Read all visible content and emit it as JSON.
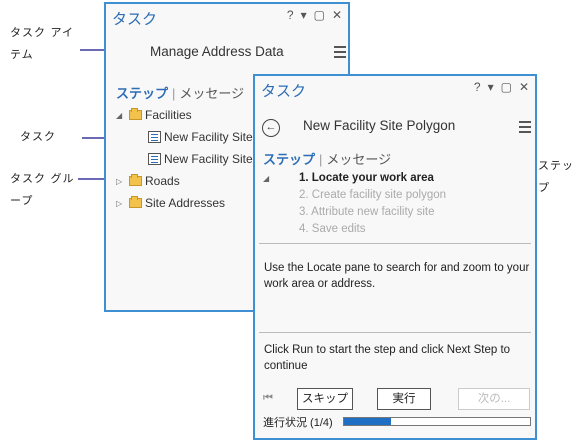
{
  "callouts": {
    "task_item": "タスク アイテム",
    "task": "タスク",
    "task_group": "タスク グループ",
    "step": "ステップ"
  },
  "back_pane": {
    "title": "タスク",
    "controls": [
      "?",
      "▾",
      "▢",
      "✕"
    ],
    "header": "Manage Address Data",
    "tab_steps": "ステップ",
    "tab_messages": "メッセージ",
    "tree": {
      "facilities": "Facilities",
      "task1": "New Facility Site",
      "task2": "New Facility Site",
      "roads": "Roads",
      "site_addresses": "Site Addresses"
    }
  },
  "front_pane": {
    "title": "タスク",
    "controls": [
      "?",
      "▾",
      "▢",
      "✕"
    ],
    "header": "New Facility Site Polygon",
    "tab_steps": "ステップ",
    "tab_messages": "メッセージ",
    "steps": [
      "1.  Locate your work area",
      "2.  Create facility site polygon",
      "3.  Attribute new facility site",
      "4.  Save edits"
    ],
    "instruction": "Use the Locate pane to search for and zoom to your work area or address.",
    "run_hint": "Click Run to start the step and click Next Step to continue",
    "buttons": {
      "skip": "スキップ",
      "run": "実行",
      "next": "次の..."
    },
    "progress_label": "進行状況 (1/4)",
    "progress_fraction": 0.25
  },
  "colors": {
    "accent": "#2d6db5",
    "border": "#3f8fd3",
    "leader": "#6b6bb5",
    "progress": "#1f6fc5"
  }
}
